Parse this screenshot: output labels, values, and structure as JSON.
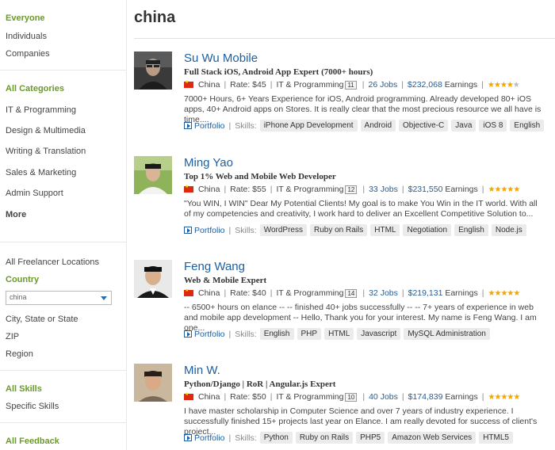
{
  "search": {
    "query": "china"
  },
  "sidebar": {
    "everyone": "Everyone",
    "individuals": "Individuals",
    "companies": "Companies",
    "all_categories": "All Categories",
    "categories": [
      "IT & Programming",
      "Design & Multimedia",
      "Writing & Translation",
      "Sales & Marketing",
      "Admin Support"
    ],
    "more": "More",
    "all_locations": "All Freelancer Locations",
    "country_label": "Country",
    "country_value": "china",
    "city_state": "City, State or State",
    "zip": "ZIP",
    "region": "Region",
    "all_skills": "All Skills",
    "specific_skills": "Specific Skills",
    "all_feedback": "All Feedback"
  },
  "labels": {
    "portfolio": "Portfolio",
    "skills": "Skills:",
    "separator": "|",
    "earnings_suffix": "Earnings"
  },
  "freelancers": [
    {
      "name": "Su Wu Mobile",
      "tagline": "Full Stack iOS, Android App Expert (7000+ hours)",
      "country": "China",
      "rate": "Rate: $45",
      "category": "IT & Programming",
      "badge": "11",
      "jobs": "26 Jobs",
      "earnings": "$232,068",
      "rating": 4,
      "description": "7000+ Hours, 6+ Years Experience for iOS, Android programming. Already developed 80+ iOS apps, 40+ Android apps on Stores. It is really clear that the most precious resource we all have is time....",
      "skills": [
        "iPhone App Development",
        "Android",
        "Objective-C",
        "Java",
        "iOS 8",
        "English"
      ]
    },
    {
      "name": "Ming Yao",
      "tagline": "Top 1% Web and Mobile Web Developer",
      "country": "China",
      "rate": "Rate: $55",
      "category": "IT & Programming",
      "badge": "12",
      "jobs": "33 Jobs",
      "earnings": "$231,550",
      "rating": 4.5,
      "description": "\"You WIN, I WIN\" Dear My Potential Clients! My goal is to make You Win in the IT world. With all of my competencies and creativity, I work hard to deliver an Excellent Competitive Solution to...",
      "skills": [
        "WordPress",
        "Ruby on Rails",
        "HTML",
        "Negotiation",
        "English",
        "Node.js"
      ]
    },
    {
      "name": "Feng Wang",
      "tagline": "Web & Mobile Expert",
      "country": "China",
      "rate": "Rate: $40",
      "category": "IT & Programming",
      "badge": "14",
      "jobs": "32 Jobs",
      "earnings": "$219,131",
      "rating": 5,
      "description": "-- 6500+ hours on elance -- -- finished 40+ jobs successfully -- -- 7+ years of experience in web and mobile app development -- Hello, Thank you for your interest. My name is Feng Wang. I am one...",
      "skills": [
        "English",
        "PHP",
        "HTML",
        "Javascript",
        "MySQL Administration"
      ]
    },
    {
      "name": "Min W.",
      "tagline": "Python/Django | RoR | Angular.js Expert",
      "country": "China",
      "rate": "Rate: $50",
      "category": "IT & Programming",
      "badge": "10",
      "jobs": "40 Jobs",
      "earnings": "$174,839",
      "rating": 5,
      "description": "I have master scholarship in Computer Science and over 7 years of industry experience. I successfully finished 15+ projects last year on Elance. I am really devoted for success of client's project...",
      "skills": [
        "Python",
        "Ruby on Rails",
        "PHP5",
        "Amazon Web Services",
        "HTML5"
      ]
    }
  ]
}
